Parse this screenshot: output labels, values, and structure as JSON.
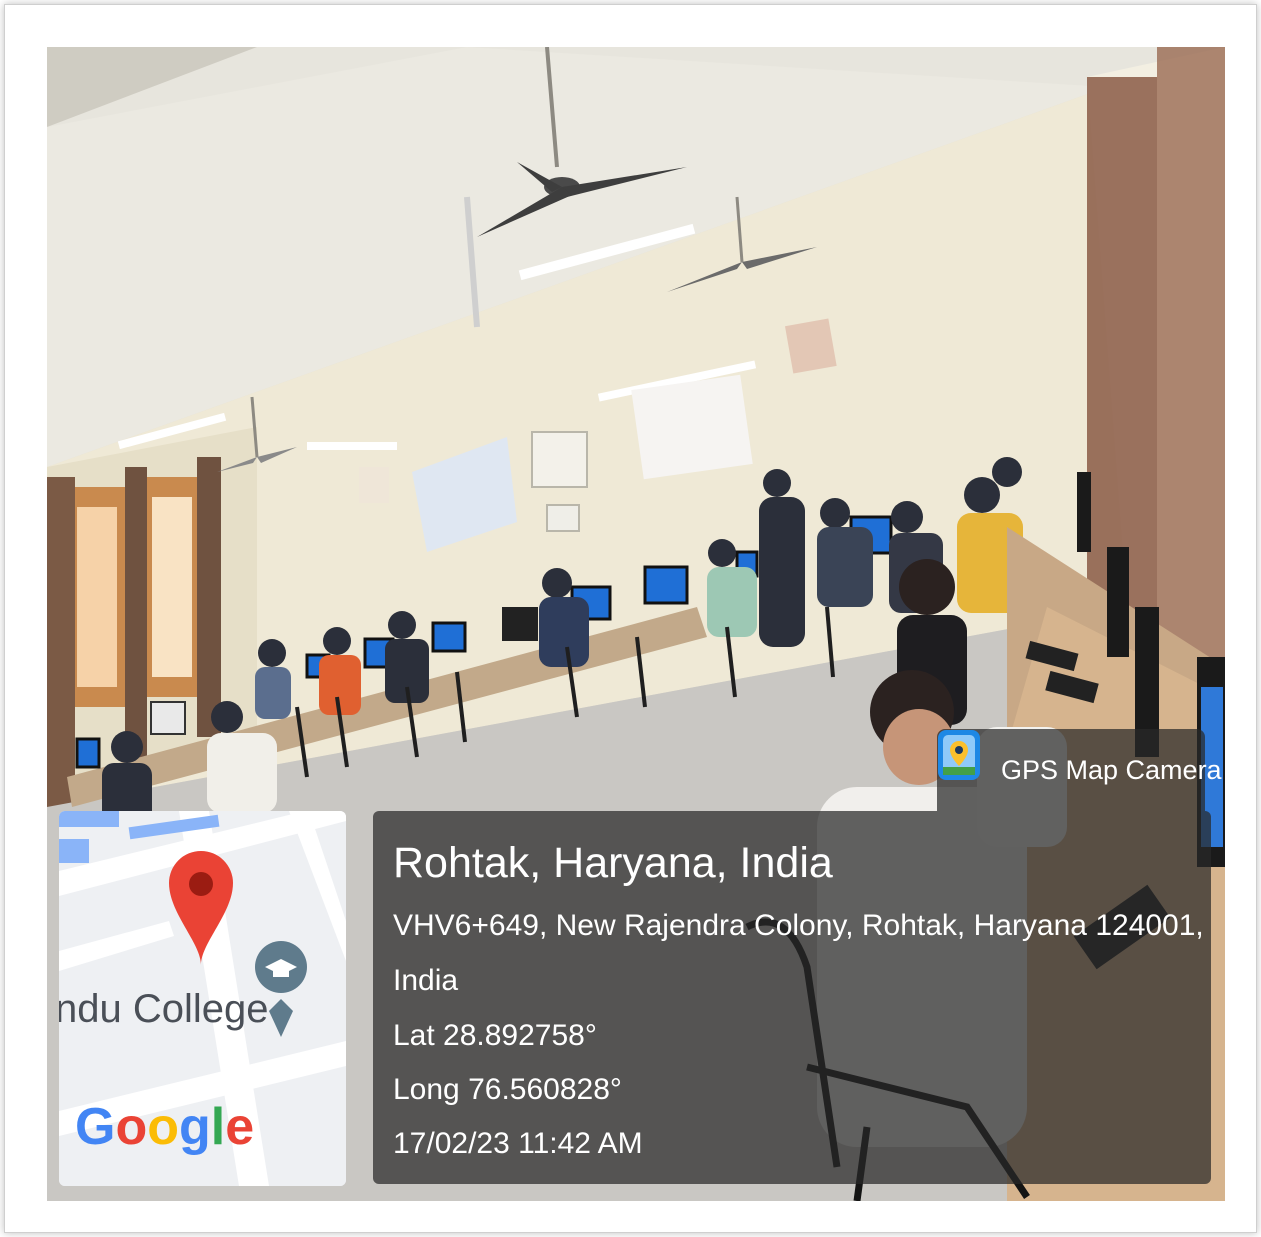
{
  "badge": {
    "app_name": "GPS Map Camera",
    "icon": "gps-map-camera-icon"
  },
  "map": {
    "place_label": "ndu College",
    "logo_text": "Google",
    "pin_icon": "map-pin-icon",
    "poi_icon": "graduation-cap-icon"
  },
  "location": {
    "title": "Rohtak, Haryana, India",
    "address_line1": "VHV6+649, New Rajendra Colony, Rohtak, Haryana 124001,",
    "address_line2": "India",
    "lat": "Lat 28.892758°",
    "long": "Long 76.560828°",
    "datetime": "17/02/23 11:42 AM"
  },
  "colors": {
    "panel": "#282828",
    "pin": "#EA4335",
    "map_bg": "#eef0f3"
  }
}
